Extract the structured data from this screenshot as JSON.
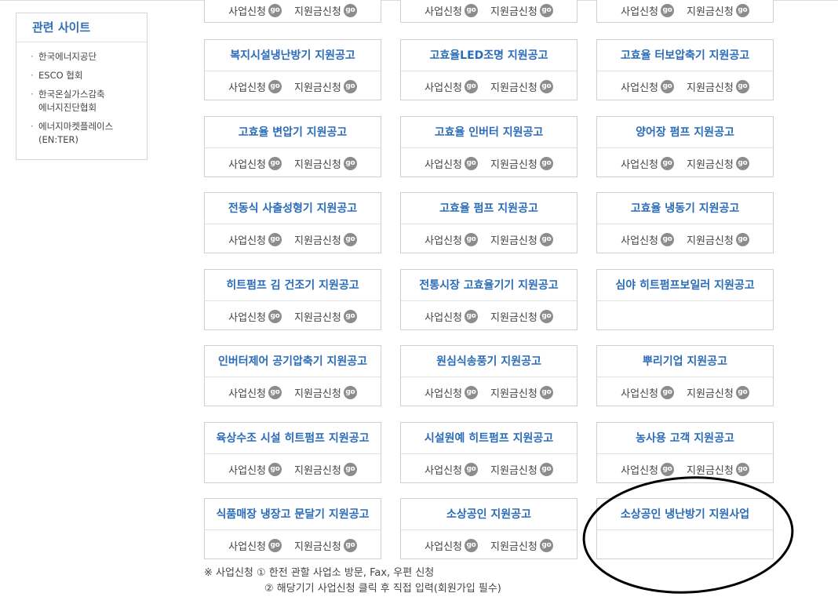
{
  "sidebar": {
    "title": "관련 사이트",
    "links": [
      {
        "lines": [
          "한국에너지공단"
        ]
      },
      {
        "lines": [
          "ESCO 협회"
        ]
      },
      {
        "lines": [
          "한국온실가스감축",
          "에너지진단협회"
        ]
      },
      {
        "lines": [
          "에너지마켓플레이스",
          "(EN:TER)"
        ]
      }
    ]
  },
  "labels": {
    "apply": "사업신청",
    "subsidy": "지원금신청",
    "go": "go"
  },
  "rows": [
    [
      {
        "title": "",
        "actions": true
      },
      {
        "title": "",
        "actions": true
      },
      {
        "title": "",
        "actions": true
      }
    ],
    [
      {
        "title": "복지시설냉난방기 지원공고",
        "actions": true
      },
      {
        "title": "고효율LED조명 지원공고",
        "actions": true
      },
      {
        "title": "고효율 터보압축기 지원공고",
        "actions": true
      }
    ],
    [
      {
        "title": "고효율 변압기 지원공고",
        "actions": true
      },
      {
        "title": "고효율 인버터 지원공고",
        "actions": true
      },
      {
        "title": "양어장 펌프 지원공고",
        "actions": true
      }
    ],
    [
      {
        "title": "전동식 사출성형기 지원공고",
        "actions": true
      },
      {
        "title": "고효율 펌프 지원공고",
        "actions": true
      },
      {
        "title": "고효율 냉동기 지원공고",
        "actions": true
      }
    ],
    [
      {
        "title": "히트펌프 김 건조기 지원공고",
        "actions": true
      },
      {
        "title": "전통시장 고효율기기 지원공고",
        "actions": true
      },
      {
        "title": "심야 히트펌프보일러 지원공고",
        "actions": false
      }
    ],
    [
      {
        "title": "인버터제어 공기압축기 지원공고",
        "actions": true
      },
      {
        "title": "원심식송풍기 지원공고",
        "actions": true
      },
      {
        "title": "뿌리기업 지원공고",
        "actions": true
      }
    ],
    [
      {
        "title": "육상수조 시설 히트펌프 지원공고",
        "actions": true
      },
      {
        "title": "시설원예 히트펌프 지원공고",
        "actions": true
      },
      {
        "title": "농사용 고객 지원공고",
        "actions": true
      }
    ],
    [
      {
        "title": "식품매장 냉장고 문달기 지원공고",
        "actions": true
      },
      {
        "title": "소상공인 지원공고",
        "actions": true
      },
      {
        "title": "소상공인 냉난방기 지원사업",
        "actions": false
      }
    ]
  ],
  "note": {
    "line1": "※ 사업신청   ① 한전 관할 사업소 방문, Fax, 우편 신청",
    "line2": "② 해당기기 사업신청 클릭 후 직접 입력(회원가입 필수)"
  }
}
